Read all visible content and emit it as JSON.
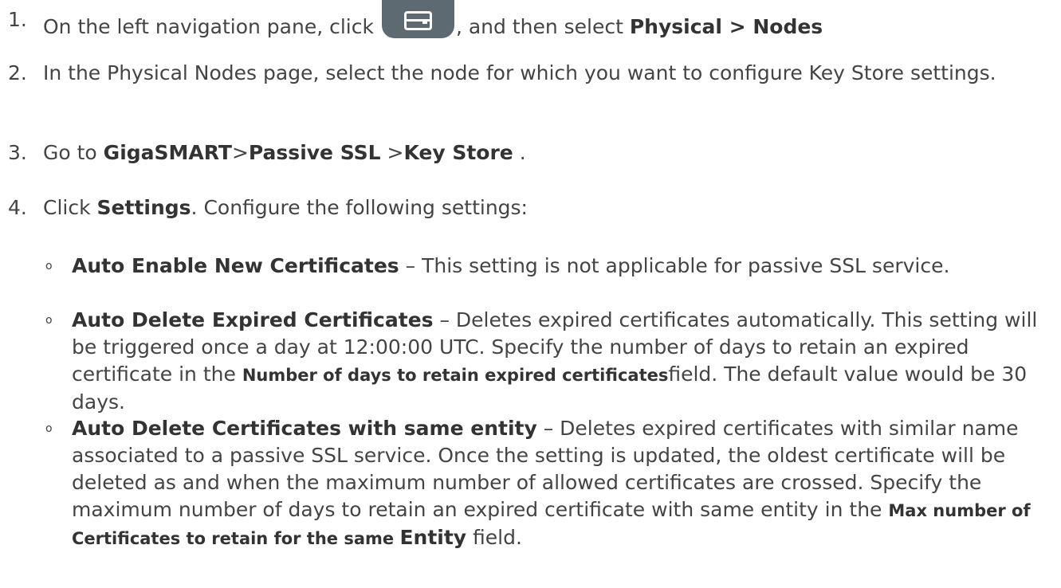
{
  "steps": [
    {
      "number": "1.",
      "before_icon": "On the left navigation pane, click ",
      "icon": "server-nav-icon",
      "after_icon": ", and then select ",
      "bold": "Physical > Nodes"
    },
    {
      "number": "2.",
      "text": "In the Physical Nodes page, select the node for which you want to configure Key Store settings."
    },
    {
      "number": "3.",
      "before": "Go to ",
      "bold1": "GigaSMART",
      "sep1": ">",
      "bold2": "Passive SSL",
      "sep2": " >",
      "bold3": "Key Store",
      "after": " ."
    },
    {
      "number": "4.",
      "before": "Click ",
      "bold": "Settings",
      "after": ". Configure the following settings:"
    }
  ],
  "settings": [
    {
      "bullet": "o",
      "name": "Auto Enable New Certificates",
      "description": " – This setting is not applicable for passive SSL service."
    },
    {
      "bullet": "o",
      "name": "Auto Delete Expired Certificates",
      "description": " – Deletes expired certificates automatically. This setting will be triggered once a day at 12:00:00 UTC. Specify the number of days to retain an expired certificate in the ",
      "field": "Number of days to retain expired certificates",
      "after": "field. The default value would be 30 days."
    },
    {
      "bullet": "o",
      "name": "Auto Delete Certificates with same entity",
      "description": " – Deletes expired certificates with similar name associated to a passive SSL service. Once the setting is updated, the oldest certificate will be deleted as and when the maximum number of allowed certificates are crossed. Specify the maximum number of days to retain an expired certificate with same entity in the ",
      "field": "Max number of Certificates to retain for the same ",
      "field_tail": "Entity",
      "after": " field."
    }
  ]
}
